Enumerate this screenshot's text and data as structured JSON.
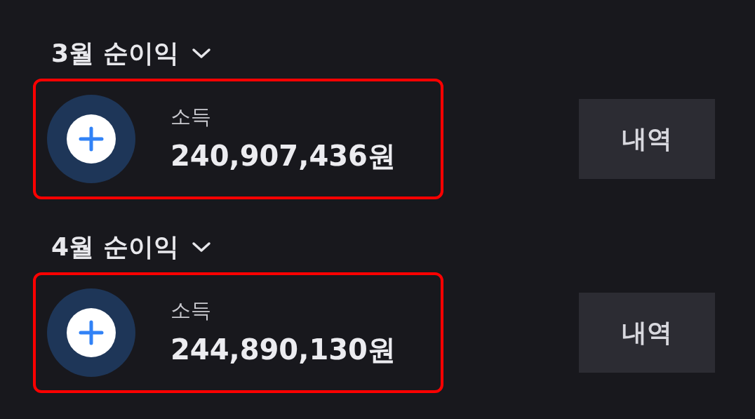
{
  "sections": [
    {
      "title": "3월 순이익",
      "highlighted": true,
      "label": "소득",
      "amount": "240,907,436원",
      "button": "내역"
    },
    {
      "title": "4월 순이익",
      "highlighted": true,
      "label": "소득",
      "amount": "244,890,130원",
      "button": "내역"
    }
  ]
}
